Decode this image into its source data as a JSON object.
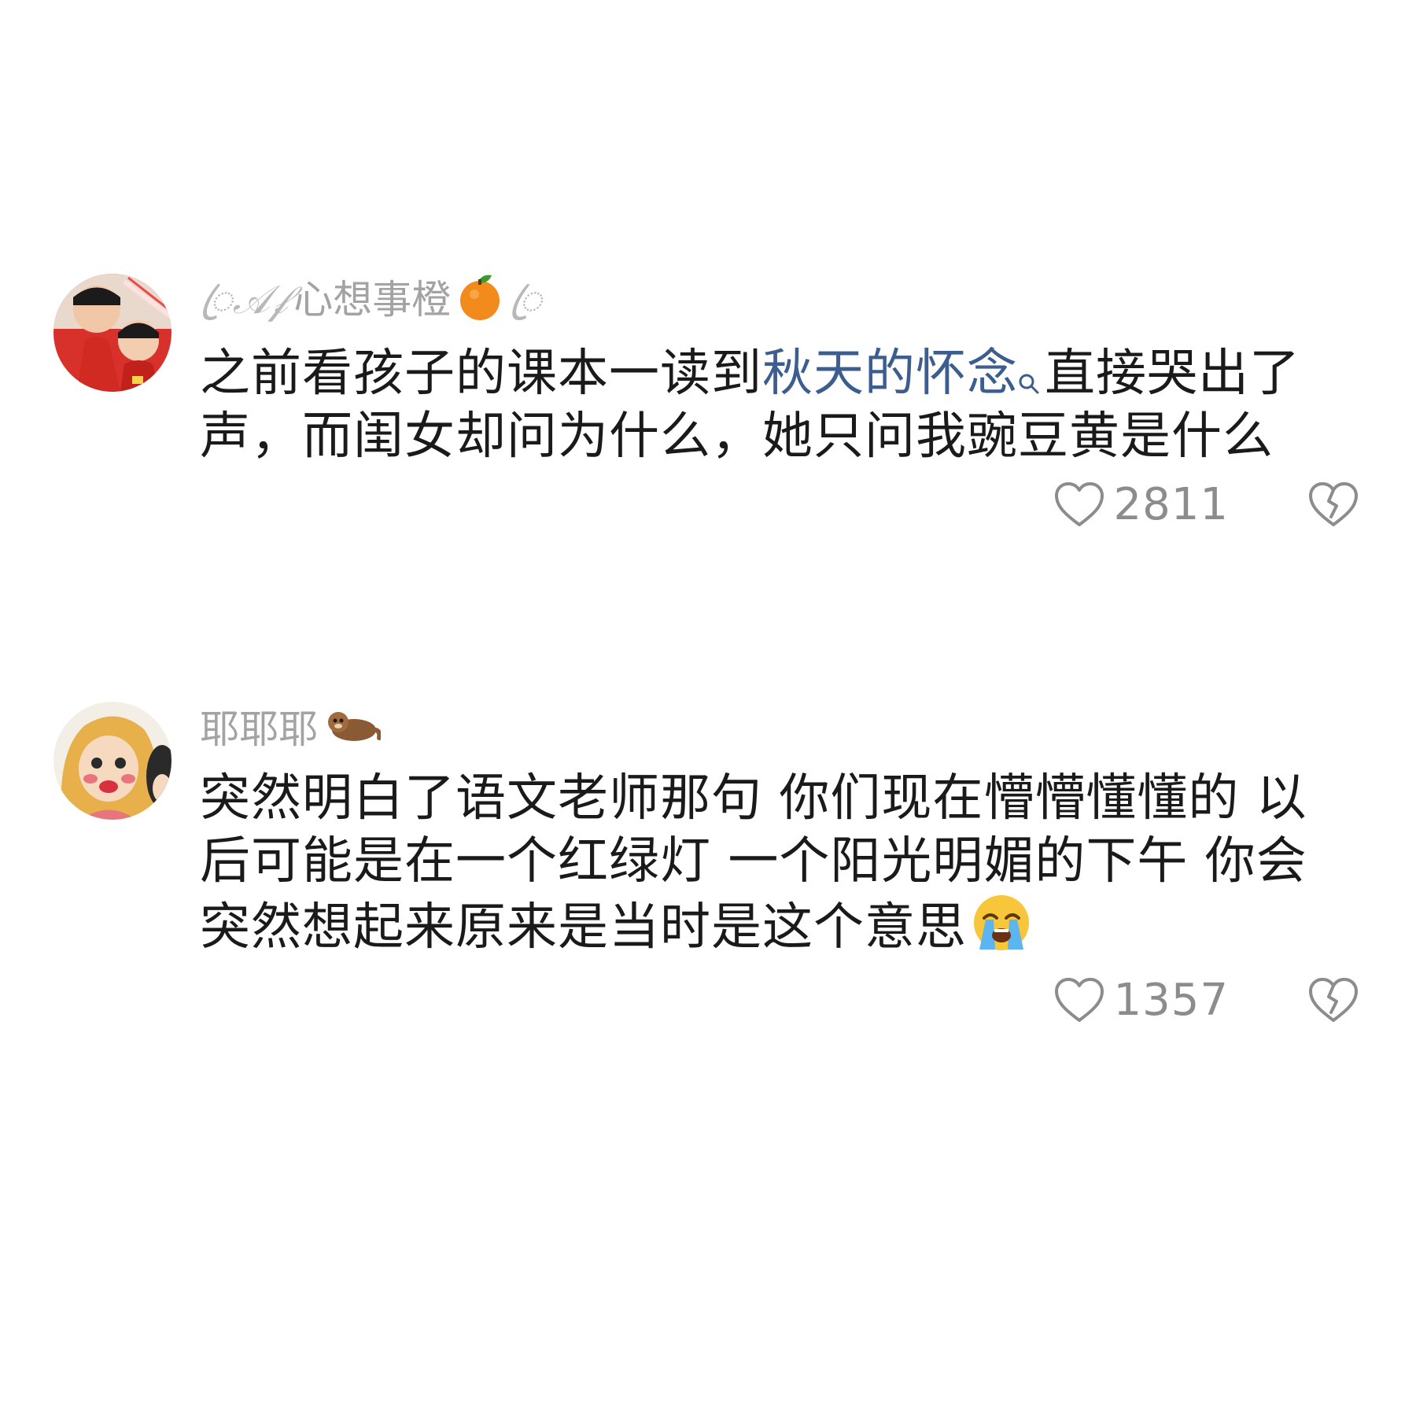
{
  "comments": [
    {
      "username_prefix": "ꦿ𝒜𝒻",
      "username_main": "心想事橙",
      "username_suffix": "ꦿ",
      "username_emoji": "tangerine-emoji",
      "text_before_link": "之前看孩子的课本一读到",
      "link_text": "秋天的怀念",
      "text_after_link": "直接哭出了声，而闺女却问为什么，她只问我豌豆黄是什么",
      "like_count": "2811"
    },
    {
      "username_main": "耶耶耶",
      "username_emoji": "otter-emoji",
      "text": "突然明白了语文老师那句 你们现在懵懵懂懂的 以后可能是在一个红绿灯 一个阳光明媚的下午 你会突然想起来原来是当时是这个意思",
      "text_emoji": "loudly-crying-face-emoji",
      "like_count": "1357"
    }
  ],
  "colors": {
    "username": "#a3a3a3",
    "link": "#3b5d8f",
    "count": "#8c8c8c",
    "text": "#1a1a1a"
  }
}
